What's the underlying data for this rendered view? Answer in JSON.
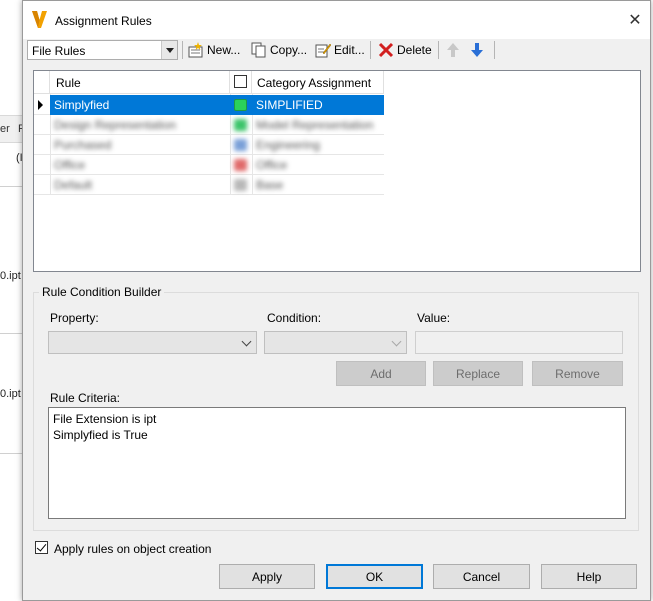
{
  "background": {
    "header_cells": [
      "er",
      "P"
    ],
    "row_texts": [
      "(I",
      "0.ipt",
      "0.ipt"
    ]
  },
  "dialog": {
    "title": "Assignment Rules",
    "close_glyph": "✕"
  },
  "toolbar": {
    "combo_value": "File Rules",
    "new_label": "New...",
    "copy_label": "Copy...",
    "edit_label": "Edit...",
    "delete_label": "Delete",
    "icons": [
      "new-icon",
      "copy-icon",
      "edit-icon",
      "delete-icon",
      "arrow-up-icon",
      "arrow-down-icon"
    ]
  },
  "grid": {
    "columns": [
      "Rule",
      "Category Assignment"
    ],
    "rows": [
      {
        "rule": "Simplyfied",
        "category": "SIMPLIFIED",
        "color": "#2bd15a",
        "selected": true
      },
      {
        "rule": "Design Representation",
        "category": "Model Representation",
        "color": "#3cc46a",
        "selected": false
      },
      {
        "rule": "Purchased",
        "category": "Engineering",
        "color": "#7aa0d8",
        "selected": false
      },
      {
        "rule": "Office",
        "category": "Office",
        "color": "#e06a6a",
        "selected": false
      },
      {
        "rule": "Default",
        "category": "Base",
        "color": "#b8b8b8",
        "selected": false
      }
    ]
  },
  "builder": {
    "group_title": "Rule Condition Builder",
    "property_label": "Property:",
    "condition_label": "Condition:",
    "value_label": "Value:",
    "add_label": "Add",
    "replace_label": "Replace",
    "remove_label": "Remove",
    "criteria_label": "Rule Criteria:",
    "criteria": [
      "File Extension is ipt",
      "Simplyfied is True"
    ]
  },
  "footer": {
    "apply_on_create_label": "Apply rules on object creation",
    "apply_on_create_checked": true,
    "apply_label": "Apply",
    "ok_label": "OK",
    "cancel_label": "Cancel",
    "help_label": "Help"
  },
  "colors": {
    "selection": "#0078d7",
    "dialog_bg": "#f0f0f0"
  }
}
